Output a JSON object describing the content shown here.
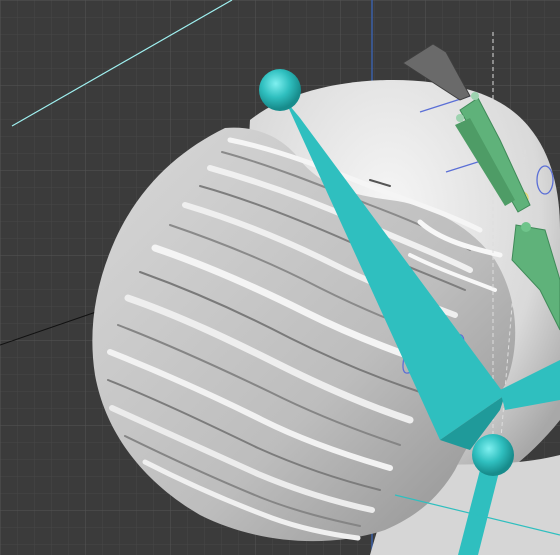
{
  "viewport": {
    "background_color": "#3b3b3b",
    "grid_minor_color": "#474747",
    "grid_major_color": "#555555",
    "y_axis_color": "#3a5fa8",
    "x_axis_color": "#111111",
    "guide_line_color": "#9ff0f0",
    "dashed_line_color": "#dddddd"
  },
  "scene": {
    "hair_mesh": {
      "base_color": "#c9c9c9",
      "highlight_color": "#f2f2f2",
      "shadow_color": "#7a7a7a"
    },
    "head_mesh": {
      "color": "#e6e6e6"
    },
    "bone_chain": {
      "color": "#2fbfbf",
      "dark_color": "#1f9a9a",
      "joint_color": "#35c9c9"
    },
    "green_bones": {
      "color": "#5fb27a",
      "dark_color": "#3f8a58"
    },
    "gray_bone": {
      "color": "#6a6a6a"
    },
    "rotation_gizmo": {
      "color": "#5b6fd6",
      "accent_color": "#e6d96b"
    }
  }
}
